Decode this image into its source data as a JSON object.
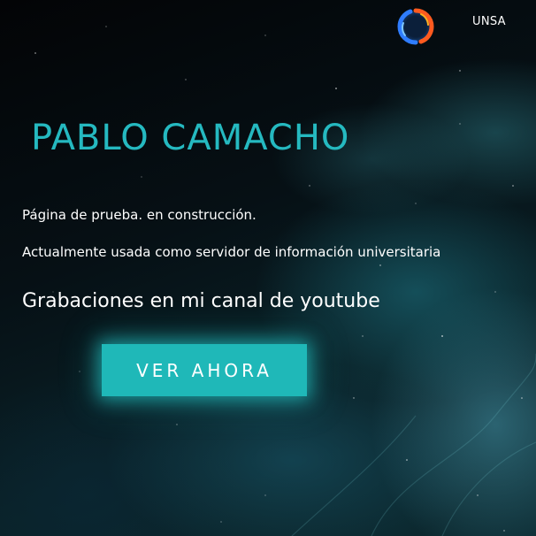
{
  "nav": {
    "logo_icon": "orb-logo-icon",
    "link_label": "UNSA"
  },
  "hero": {
    "title": "PABLO CAMACHO",
    "line1": "Página de prueba. en construcción.",
    "line2": "Actualmente usada como servidor de información universitaria",
    "line3": "Grabaciones en mi canal de youtube",
    "cta_label": "VER AHORA"
  },
  "colors": {
    "accent": "#25b9c0",
    "button_bg": "#1fb8b8",
    "background": "#05070b",
    "text": "#ffffff"
  }
}
